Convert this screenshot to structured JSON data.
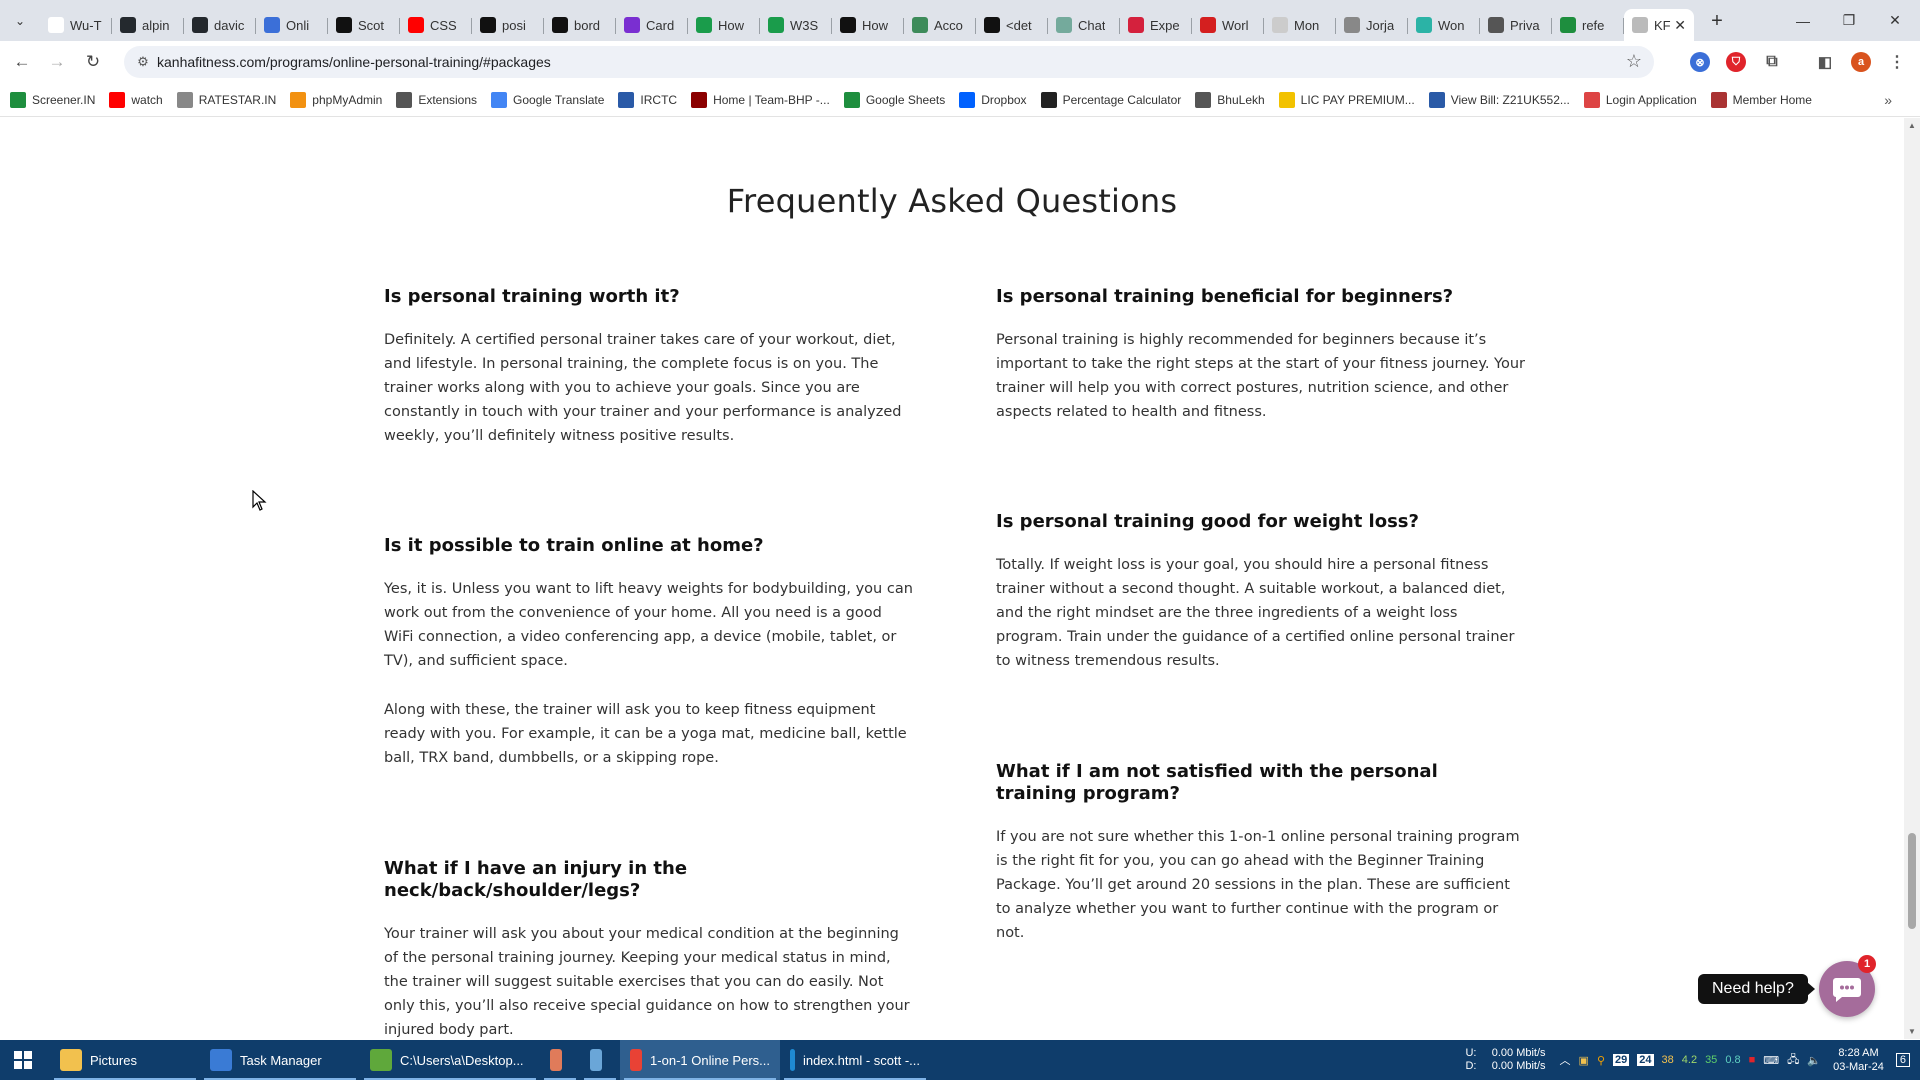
{
  "browser": {
    "tabs": [
      {
        "title": "Wu-T",
        "icon": "google-icon",
        "color": "#ffffff"
      },
      {
        "title": "alpin",
        "icon": "github-icon",
        "color": "#24292e"
      },
      {
        "title": "davic",
        "icon": "github-icon",
        "color": "#24292e"
      },
      {
        "title": "Onli",
        "icon": "site-icon",
        "color": "#3b6fd8"
      },
      {
        "title": "Scot",
        "icon": "s-icon",
        "color": "#111111"
      },
      {
        "title": "CSS",
        "icon": "youtube-icon",
        "color": "#ff0000"
      },
      {
        "title": "posi",
        "icon": "medium-icon",
        "color": "#111111"
      },
      {
        "title": "bord",
        "icon": "medium-icon",
        "color": "#111111"
      },
      {
        "title": "Card",
        "icon": "b-icon",
        "color": "#7a2fd1"
      },
      {
        "title": "How",
        "icon": "w-icon",
        "color": "#1a9c4b"
      },
      {
        "title": "W3S",
        "icon": "w-icon",
        "color": "#1a9c4b"
      },
      {
        "title": "How",
        "icon": "a-icon",
        "color": "#111111"
      },
      {
        "title": "Acco",
        "icon": "dots-icon",
        "color": "#3d8b5a"
      },
      {
        "title": "<det",
        "icon": "medium-icon",
        "color": "#111111"
      },
      {
        "title": "Chat",
        "icon": "chatgpt-icon",
        "color": "#74aa9c"
      },
      {
        "title": "Expe",
        "icon": "x-icon",
        "color": "#d4213d"
      },
      {
        "title": "Worl",
        "icon": "w-icon",
        "color": "#d41f1f"
      },
      {
        "title": "Mon",
        "icon": "cloud-icon",
        "color": "#cccccc"
      },
      {
        "title": "Jorja",
        "icon": "script-icon",
        "color": "#888888"
      },
      {
        "title": "Won",
        "icon": "v-icon",
        "color": "#2bb3a6"
      },
      {
        "title": "Priva",
        "icon": "lines-icon",
        "color": "#555555"
      },
      {
        "title": "refe",
        "icon": "sheets-icon",
        "color": "#1e8e3e"
      },
      {
        "title": "KF",
        "icon": "kf-icon",
        "color": "#bbbbbb"
      }
    ],
    "url": "kanhafitness.com/programs/online-personal-training/#packages",
    "avatar_letter": "a",
    "bookmarks": [
      {
        "label": "Screener.IN",
        "icon": "bar-chart-icon",
        "color": "#1e8e3e"
      },
      {
        "label": "watch",
        "icon": "youtube-icon",
        "color": "#ff0000"
      },
      {
        "label": "RATESTAR.IN",
        "icon": "star-icon",
        "color": "#888888"
      },
      {
        "label": "phpMyAdmin",
        "icon": "php-icon",
        "color": "#f29111"
      },
      {
        "label": "Extensions",
        "icon": "puzzle-icon",
        "color": "#555555"
      },
      {
        "label": "Google Translate",
        "icon": "translate-icon",
        "color": "#4285f4"
      },
      {
        "label": "IRCTC",
        "icon": "irctc-icon",
        "color": "#2a5aa7"
      },
      {
        "label": "Home | Team-BHP -...",
        "icon": "teambhp-icon",
        "color": "#8b0000"
      },
      {
        "label": "Google Sheets",
        "icon": "sheets-icon",
        "color": "#1e8e3e"
      },
      {
        "label": "Dropbox",
        "icon": "dropbox-icon",
        "color": "#0061fe"
      },
      {
        "label": "Percentage Calculator",
        "icon": "calc-icon",
        "color": "#222222"
      },
      {
        "label": "BhuLekh",
        "icon": "globe-icon",
        "color": "#555555"
      },
      {
        "label": "LIC PAY PREMIUM...",
        "icon": "lic-icon",
        "color": "#f2c200"
      },
      {
        "label": "View Bill: Z21UK552...",
        "icon": "bill-icon",
        "color": "#2a5aa7"
      },
      {
        "label": "Login Application",
        "icon": "login-icon",
        "color": "#d44"
      },
      {
        "label": "Member Home",
        "icon": "member-icon",
        "color": "#a33"
      }
    ]
  },
  "page": {
    "section_title": "Frequently Asked Questions",
    "faqs_left": [
      {
        "question": "Is personal training worth it?",
        "answer": [
          "Definitely. A certified personal trainer takes care of your workout, diet, and lifestyle. In personal training, the complete focus is on you. The trainer works along with you to achieve your goals. Since you are constantly in touch with your trainer and your performance is analyzed weekly, you’ll definitely witness positive results."
        ]
      },
      {
        "question": "Is it possible to train online at home?",
        "answer": [
          "Yes, it is. Unless you want to lift heavy weights for bodybuilding, you can work out from the convenience of your home. All you need is a good WiFi connection, a video conferencing app, a device (mobile, tablet, or TV), and sufficient space.",
          "Along with these, the trainer will ask you to keep fitness equipment ready with you. For example, it can be a yoga mat, medicine ball, kettle ball, TRX band, dumbbells, or a skipping rope."
        ]
      },
      {
        "question": "What if I have an injury in the neck/back/shoulder/legs?",
        "answer": [
          "Your trainer will ask you about your medical condition at the beginning of the personal training journey. Keeping your medical status in mind, the trainer will suggest suitable exercises that you can do easily. Not only this, you’ll also receive special guidance on how to strengthen your injured body part."
        ]
      }
    ],
    "faqs_right": [
      {
        "question": "Is personal training beneficial for beginners?",
        "answer": [
          "Personal training is highly recommended for beginners because it’s important to take the right steps at the start of your fitness journey. Your trainer will help you with correct postures, nutrition science, and other aspects related to health and fitness."
        ]
      },
      {
        "question": "Is personal training good for weight loss?",
        "answer": [
          "Totally. If weight loss is your goal, you should hire a personal fitness trainer without a second thought. A suitable workout, a balanced diet, and the right mindset are the three ingredients of a weight loss program. Train under the guidance of a certified online personal trainer to witness tremendous results."
        ]
      },
      {
        "question": "What if I am not satisfied with the personal training program?",
        "answer": [
          "If you are not sure whether this 1-on-1 online personal training program is the right fit for you, you can go ahead with the Beginner Training Package. You’ll get around 20 sessions in the plan. These are sufficient to analyze whether you want to further continue with the program or not."
        ]
      }
    ],
    "help_label": "Need help?",
    "chat_badge_count": "1",
    "chat_color": "#a56c9b"
  },
  "taskbar": {
    "items": [
      {
        "label": "Pictures",
        "icon": "folder-icon",
        "color": "#f2c14e"
      },
      {
        "label": "Task Manager",
        "icon": "task-manager-icon",
        "color": "#3a7bd5"
      },
      {
        "label": "C:\\Users\\a\\Desktop...",
        "icon": "notepadpp-icon",
        "color": "#5fa83b"
      },
      {
        "label": "",
        "icon": "app-icon",
        "color": "#e07b5a"
      },
      {
        "label": "",
        "icon": "notepad-icon",
        "color": "#6aa6d8"
      },
      {
        "label": "1-on-1 Online Pers...",
        "icon": "chrome-icon",
        "color": "#e94235"
      },
      {
        "label": "index.html - scott -...",
        "icon": "vscode-icon",
        "color": "#1f8ad2"
      }
    ],
    "net_up_label": "U:",
    "net_down_label": "D:",
    "net_up": "0.00 Mbit/s",
    "net_down": "0.00 Mbit/s",
    "tray_numbers": [
      "38",
      "4.2",
      "35",
      "0.8"
    ],
    "tray_date_num": "29",
    "tray_24": "24",
    "time": "8:28 AM",
    "date": "03-Mar-24",
    "notif_count": "6"
  }
}
